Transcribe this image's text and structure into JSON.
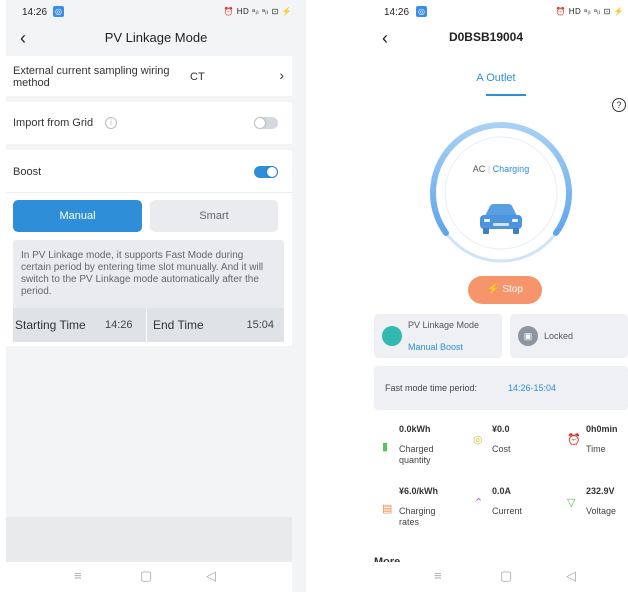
{
  "left": {
    "status": {
      "time": "14:26",
      "icons": "⏰ HD ᵃᵢₗ ᵃᵢₗ ⊡ ⚡"
    },
    "header": {
      "title": "PV Linkage Mode"
    },
    "wiring": {
      "label": "External current sampling wiring method",
      "value": "CT"
    },
    "import_grid": {
      "label": "Import from Grid",
      "enabled": false
    },
    "boost": {
      "label": "Boost",
      "enabled": true
    },
    "mode_buttons": {
      "manual": "Manual",
      "smart": "Smart",
      "selected": "Manual"
    },
    "info": "In PV Linkage mode, it supports Fast Mode during certain period by entering time slot munually. And it will switch to the PV Linkage mode automatically after the period.",
    "time": {
      "start_label": "Starting Time",
      "start_value": "14:26",
      "end_label": "End Time",
      "end_value": "15:04"
    },
    "colors": {
      "accent": "#2e8fd8",
      "toggle_off": "#d5d8dd"
    }
  },
  "right": {
    "status": {
      "time": "14:26",
      "icons": "⏰ HD ᵃᵢₗ ᵃᵢₗ ⊡ ⚡"
    },
    "header": {
      "title": "D0BSB19004"
    },
    "tab": "A Outlet",
    "state": {
      "type": "AC",
      "status": "Charging"
    },
    "stop_label": "Stop",
    "mode_card": {
      "title": "PV Linkage Mode",
      "subtitle": "Manual Boost"
    },
    "lock_card": {
      "label": "Locked"
    },
    "fast_mode": {
      "label": "Fast mode time period:",
      "value": "14:26-15:04"
    },
    "metrics": [
      {
        "value": "0.0kWh",
        "label": "Charged quantity",
        "icon": "battery-icon",
        "color": "#58c25f"
      },
      {
        "value": "¥0.0",
        "label": "Cost",
        "icon": "coin-icon",
        "color": "#e6c43a"
      },
      {
        "value": "0h0min",
        "label": "Time",
        "icon": "clock-icon",
        "color": "#3aa0e6"
      },
      {
        "value": "¥6.0/kWh",
        "label": "Charging rates",
        "icon": "rates-icon",
        "color": "#f08a4b"
      },
      {
        "value": "0.0A",
        "label": "Current",
        "icon": "current-icon",
        "color": "#a25ad8"
      },
      {
        "value": "232.9V",
        "label": "Voltage",
        "icon": "voltage-icon",
        "color": "#5abf4a"
      }
    ],
    "more": "More",
    "colors": {
      "accent": "#2e8fd8",
      "stop": "#f6956b",
      "ring": "#7fb8ee"
    }
  }
}
